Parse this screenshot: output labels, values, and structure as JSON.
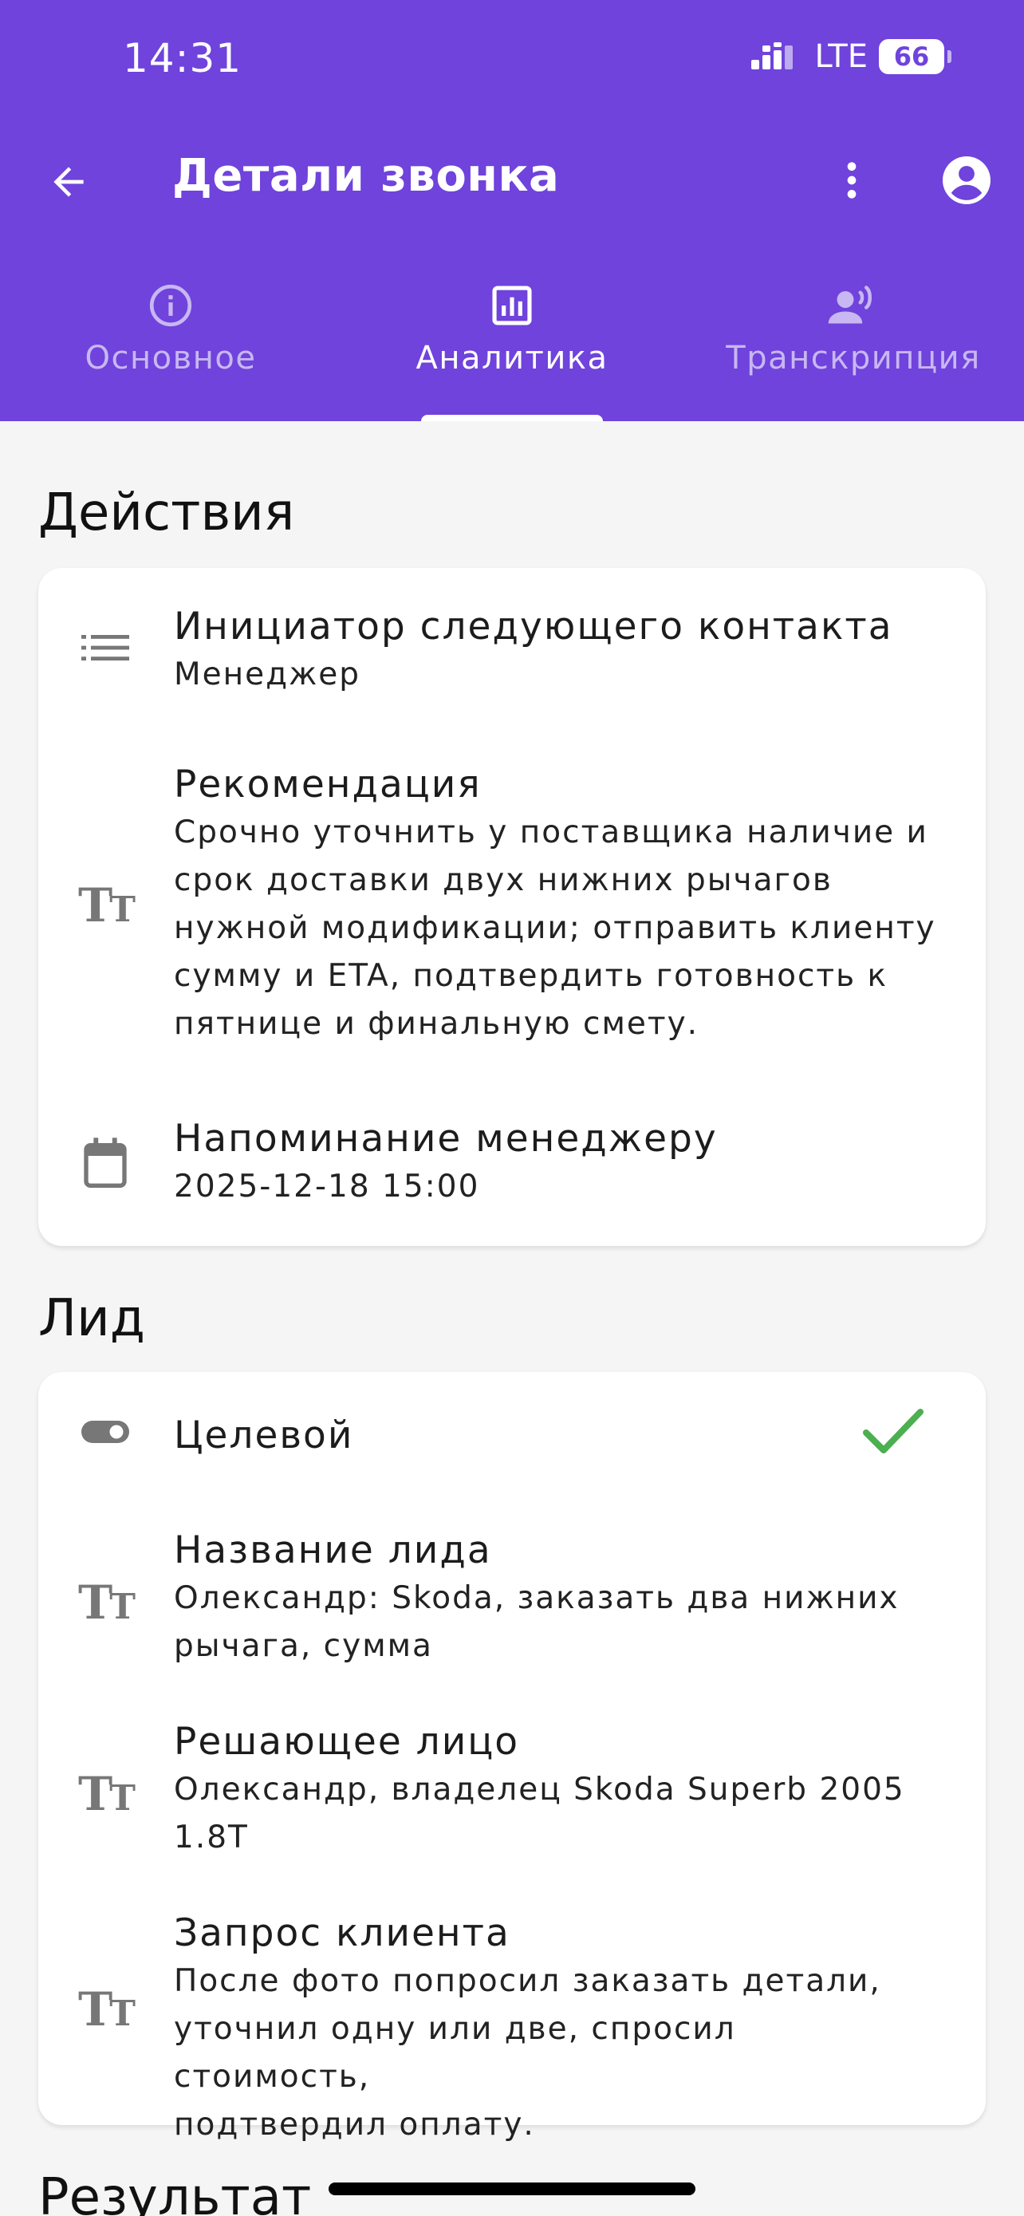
{
  "status_bar": {
    "time": "14:31",
    "network": "LTE",
    "battery": "66"
  },
  "header": {
    "title": "Детали звонка"
  },
  "tabs": [
    {
      "label": "Основное",
      "icon": "info-icon",
      "active": false
    },
    {
      "label": "Аналитика",
      "icon": "analytics-icon",
      "active": true
    },
    {
      "label": "Транскрипция",
      "icon": "voice-icon",
      "active": false
    }
  ],
  "actions": {
    "title": "Действия",
    "items": [
      {
        "label": "Инициатор следующего контакта",
        "value": "Менеджер",
        "icon": "list-icon"
      },
      {
        "label": "Рекомендация",
        "value_lines": [
          "Срочно уточнить у поставщика наличие и",
          "срок доставки двух нижних рычагов",
          "нужной модификации; отправить клиенту",
          "сумму и ETA, подтвердить готовность к",
          "пятнице и финальную смету."
        ],
        "icon": "text-icon"
      },
      {
        "label": "Напоминание менеджеру",
        "value": "2025-12-18 15:00",
        "icon": "calendar-icon"
      }
    ]
  },
  "lead": {
    "title": "Лид",
    "items": [
      {
        "label": "Целевой",
        "icon": "toggle-icon",
        "checked": true
      },
      {
        "label": "Название лида",
        "value_lines": [
          "Олександр: Skoda, заказать два нижних",
          "рычага, сумма"
        ],
        "icon": "text-icon"
      },
      {
        "label": "Решающее лицо",
        "value_lines": [
          "Олександр, владелец Skoda Superb 2005",
          "1.8T"
        ],
        "icon": "text-icon"
      },
      {
        "label": "Запрос клиента",
        "value_lines": [
          "После фото попросил заказать детали,",
          "уточнил одну или две, спросил стоимость,",
          "подтвердил оплату."
        ],
        "icon": "text-icon"
      }
    ]
  },
  "result": {
    "title": "Результат"
  },
  "colors": {
    "primary": "#6f43dc",
    "check": "#4caf50",
    "icon_gray": "#777777"
  }
}
